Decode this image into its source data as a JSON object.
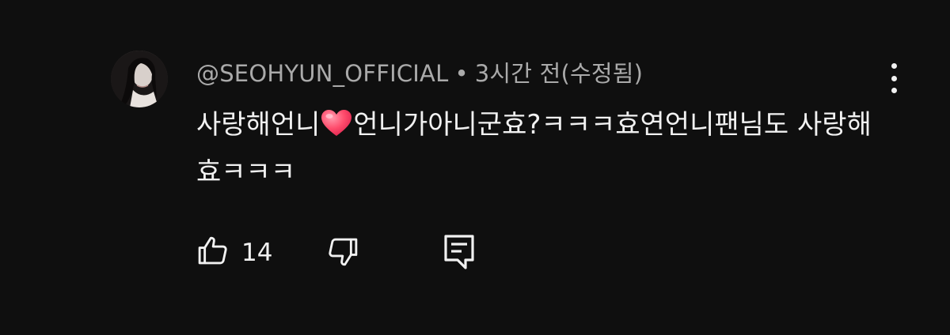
{
  "comment": {
    "author": "@SEOHYUN_OFFICIAL",
    "separator": "•",
    "time": "3시간 전(수정됨)",
    "text_part1": "사랑해언니",
    "heart_emoji": "red-heart",
    "text_part2": "언니가아니군효?ㅋㅋㅋ효연언니팬님도 사랑해효ㅋㅋㅋ",
    "like_count": "14"
  },
  "icons": {
    "avatar": "profile-photo",
    "more": "more-vert-icon",
    "like": "thumbs-up-icon",
    "dislike": "thumbs-down-icon",
    "reply": "reply-comment-icon"
  },
  "colors": {
    "background": "#0f0f0f",
    "primary_text": "#f1f1f1",
    "secondary_text": "#aaaaaa",
    "heart": "#ff4d6d"
  }
}
